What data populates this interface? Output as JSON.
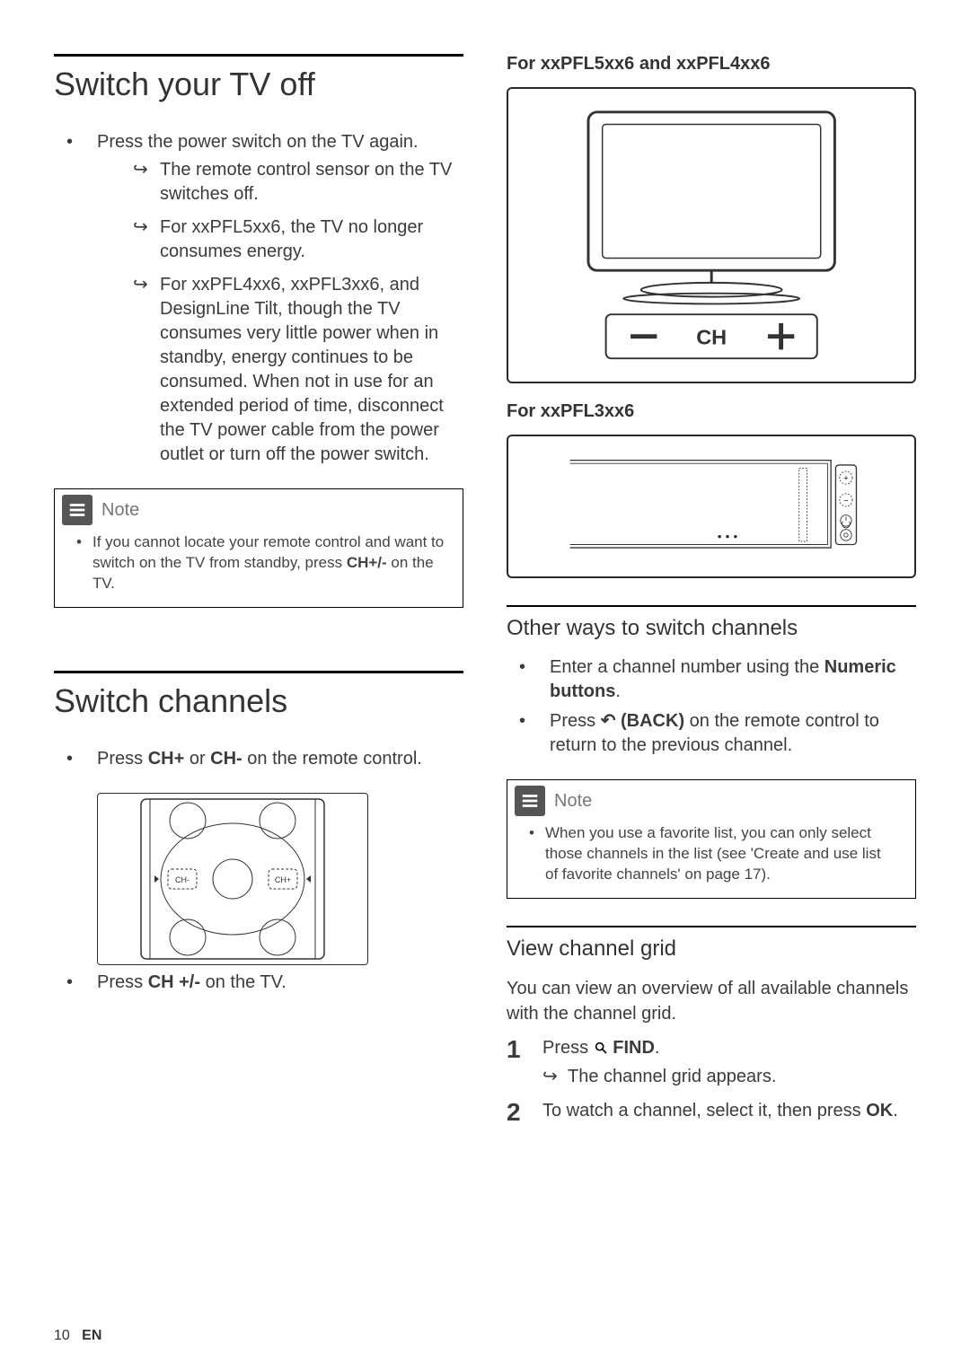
{
  "left": {
    "section1": {
      "title": "Switch your TV off",
      "bullet": "Press the power switch on the TV again.",
      "sub1": "The remote control sensor on the TV switches off.",
      "sub2": "For xxPFL5xx6, the TV no longer consumes energy.",
      "sub3": "For xxPFL4xx6, xxPFL3xx6, and DesignLine Tilt, though the TV consumes very little power when in standby, energy continues to be consumed. When not in use for an extended period of time, disconnect the TV power cable from the power outlet or turn off the power switch."
    },
    "note1": {
      "label": "Note",
      "body_pre": "If you cannot locate your remote control and want to switch on the TV from standby, press ",
      "body_bold": "CH+/-",
      "body_post": " on the TV."
    },
    "section2": {
      "title": "Switch channels",
      "press_pre": "Press ",
      "ch_plus": "CH+",
      "or": " or ",
      "ch_minus": "CH-",
      "press_post": " on the remote control.",
      "bullet2_pre": "Press ",
      "bullet2_bold": "CH +/-",
      "bullet2_post": " on the TV."
    },
    "remote_labels": {
      "ch_minus": "CH-",
      "ch_plus": "CH+"
    }
  },
  "right": {
    "model1": "For xxPFL5xx6 and xxPFL4xx6",
    "tv_label": "CH",
    "model2": "For xxPFL3xx6",
    "section_other": {
      "title": "Other ways to switch channels",
      "b1_pre": "Enter a channel number using the ",
      "b1_bold": "Numeric buttons",
      "b1_post": ".",
      "b2_pre": "Press ",
      "b2_icon_name": "back-icon",
      "b2_bold": " (BACK)",
      "b2_post": " on the remote control to return to the previous channel."
    },
    "note2": {
      "label": "Note",
      "body": "When you use a favorite list, you can only select those channels in the list (see 'Create and use list of favorite channels' on page 17)."
    },
    "section_view": {
      "title": "View channel grid",
      "intro": "You can view an overview of all available channels with the channel grid.",
      "step1_pre": "Press ",
      "step1_icon_name": "find-icon",
      "step1_bold": " FIND",
      "step1_post": ".",
      "step1_result": "The channel grid appears.",
      "step2_pre": "To watch a channel, select it, then press ",
      "step2_bold": "OK",
      "step2_post": "."
    }
  },
  "footer": {
    "page_num": "10",
    "lang": "EN"
  }
}
